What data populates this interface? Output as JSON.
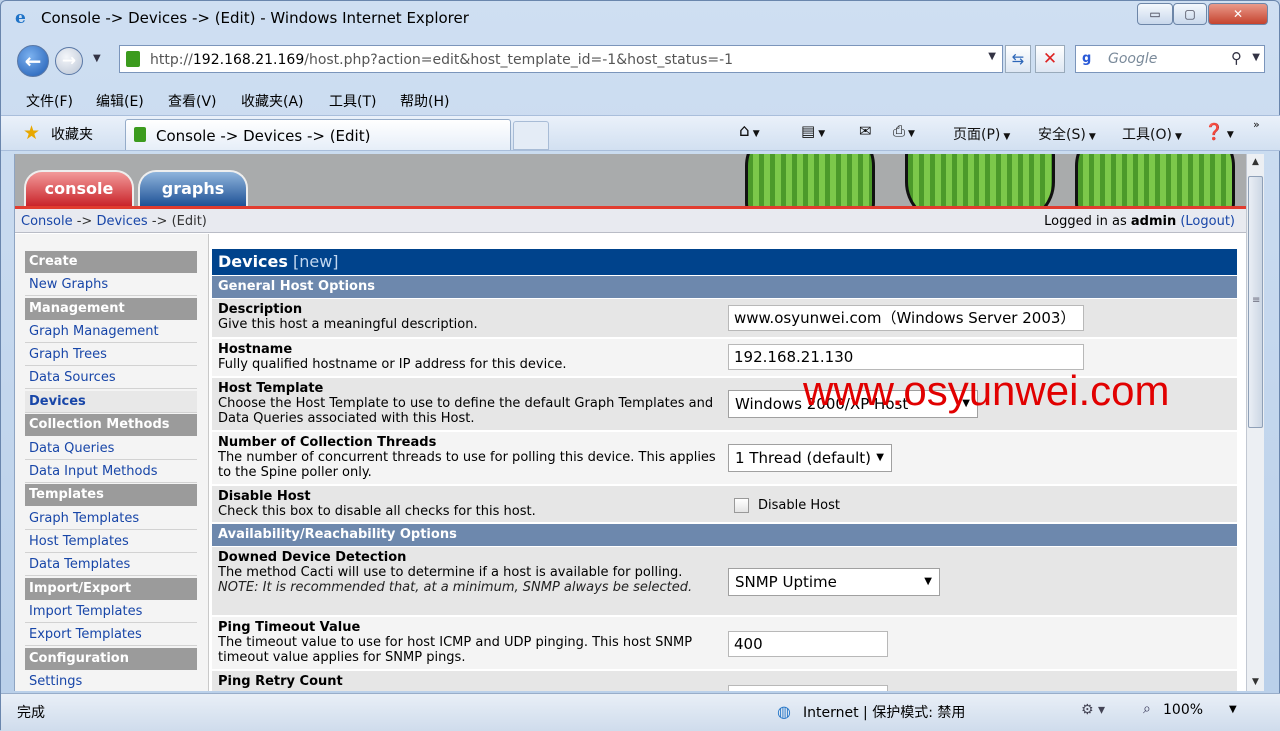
{
  "window": {
    "title": "Console -> Devices -> (Edit) - Windows Internet Explorer",
    "min_label": "▭",
    "max_label": "▢",
    "close_label": "✕"
  },
  "address": {
    "url_prefix": "http://",
    "url_host": "192.168.21.169",
    "url_path": "/host.php?action=edit&host_template_id=-1&host_status=-1",
    "search_placeholder": "Google"
  },
  "menu": [
    "文件(F)",
    "编辑(E)",
    "查看(V)",
    "收藏夹(A)",
    "工具(T)",
    "帮助(H)"
  ],
  "favorites": {
    "label": "收藏夹",
    "tab_title": "Console -> Devices -> (Edit)"
  },
  "toolbar": {
    "page": "页面(P)",
    "safety": "安全(S)",
    "tools": "工具(O)"
  },
  "cacti": {
    "tab_console": "console",
    "tab_graphs": "graphs",
    "breadcrumb": {
      "console": "Console",
      "sep1": " -> ",
      "devices": "Devices",
      "sep2": " -> ",
      "current": "(Edit)"
    },
    "login": {
      "prefix": "Logged in as ",
      "user": "admin",
      "logout": "(Logout)"
    }
  },
  "nav": {
    "create": "Create",
    "new_graphs": "New Graphs",
    "management": "Management",
    "graph_management": "Graph Management",
    "graph_trees": "Graph Trees",
    "data_sources": "Data Sources",
    "devices": "Devices",
    "collection_methods": "Collection Methods",
    "data_queries": "Data Queries",
    "data_input_methods": "Data Input Methods",
    "templates": "Templates",
    "graph_templates": "Graph Templates",
    "host_templates": "Host Templates",
    "data_templates": "Data Templates",
    "import_export": "Import/Export",
    "import_templates": "Import Templates",
    "export_templates": "Export Templates",
    "configuration": "Configuration",
    "settings": "Settings"
  },
  "form": {
    "title": "Devices",
    "title_suffix": " [new]",
    "section_general": "General Host Options",
    "description": {
      "label": "Description",
      "help": "Give this host a meaningful description.",
      "value": "www.osyunwei.com（Windows Server 2003）"
    },
    "hostname": {
      "label": "Hostname",
      "help": "Fully qualified hostname or IP address for this device.",
      "value": "192.168.21.130"
    },
    "host_template": {
      "label": "Host Template",
      "help": "Choose the Host Template to use to define the default Graph Templates and Data Queries associated with this Host.",
      "value": "Windows 2000/XP Host"
    },
    "threads": {
      "label": "Number of Collection Threads",
      "help": "The number of concurrent threads to use for polling this device. This applies to the Spine poller only.",
      "value": "1 Thread (default)"
    },
    "disable": {
      "label": "Disable Host",
      "help": "Check this box to disable all checks for this host.",
      "checkbox_label": "Disable Host"
    },
    "section_availability": "Availability/Reachability Options",
    "downed": {
      "label": "Downed Device Detection",
      "help": "The method Cacti will use to determine if a host is available for polling.",
      "note": "NOTE: It is recommended that, at a minimum, SNMP always be selected.",
      "value": "SNMP Uptime"
    },
    "ping_timeout": {
      "label": "Ping Timeout Value",
      "help": "The timeout value to use for host ICMP and UDP pinging. This host SNMP timeout value applies for SNMP pings.",
      "value": "400"
    },
    "ping_retry": {
      "label": "Ping Retry Count"
    }
  },
  "watermark": "www.osyunwei.com",
  "status": {
    "text": "完成",
    "zone": "Internet | 保护模式: 禁用",
    "zoom": "100%"
  },
  "colors": {
    "cacti_header": "#00438c",
    "section_header": "#6d88ad",
    "nav_header": "#9b9b9b",
    "tab_console": "#c9242a",
    "tab_graphs": "#1f5296",
    "watermark": "#e10000"
  },
  "icons": [
    "ie-logo-icon",
    "back-icon",
    "forward-icon",
    "page-icon",
    "refresh-icon",
    "stop-icon",
    "google-icon",
    "search-icon",
    "star-icon",
    "home-icon",
    "feeds-icon",
    "mail-icon",
    "print-icon",
    "help-icon",
    "globe-icon",
    "zoom-icon"
  ]
}
